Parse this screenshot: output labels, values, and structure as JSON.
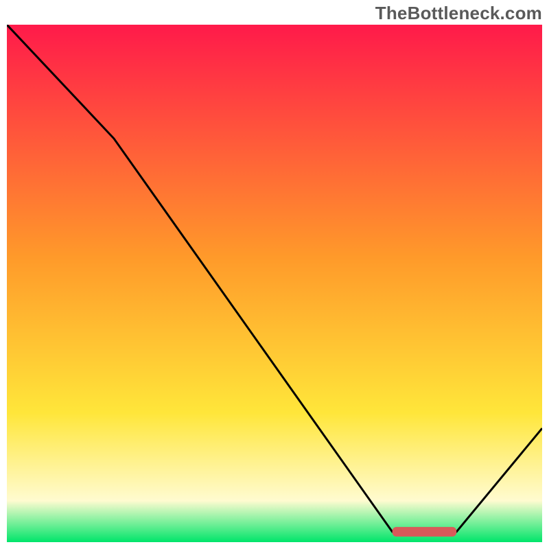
{
  "watermark": "TheBottleneck.com",
  "colors": {
    "gradient_top": "#ff1a4a",
    "gradient_mid1": "#ff9a2a",
    "gradient_mid2": "#ffe63a",
    "gradient_low": "#fffbd0",
    "gradient_bottom": "#00e56a",
    "curve": "#000000",
    "marker": "#d85a5a"
  },
  "chart_data": {
    "type": "line",
    "title": "",
    "xlabel": "",
    "ylabel": "",
    "xlim": [
      0,
      100
    ],
    "ylim": [
      0,
      100
    ],
    "x": [
      0,
      20,
      72,
      78,
      84,
      100
    ],
    "values": [
      100,
      78,
      2,
      2,
      2,
      22
    ],
    "marker": {
      "x_start": 72,
      "x_end": 84,
      "y": 2
    }
  }
}
